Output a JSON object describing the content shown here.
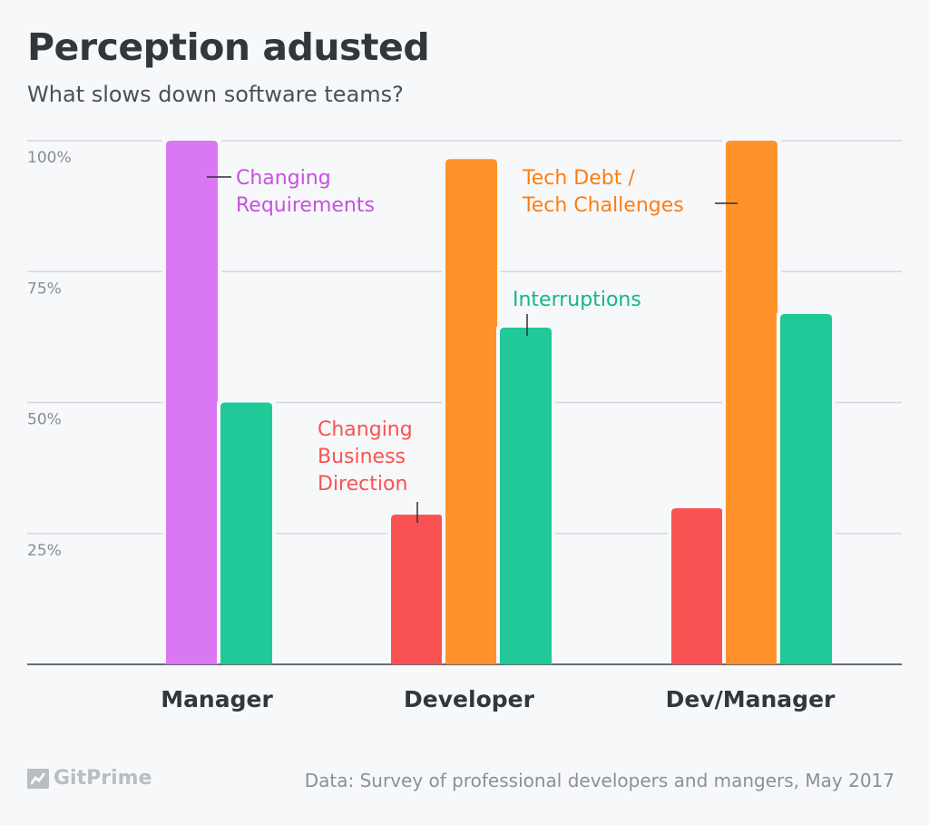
{
  "header": {
    "title": "Perception adusted",
    "subtitle": "What slows down software teams?"
  },
  "footer": {
    "logo_text": "GitPrime",
    "logo_icon": "gitprime-chart-icon",
    "source": "Data: Survey of professional developers and mangers, May 2017"
  },
  "colors": {
    "changing_requirements": "#da77f2",
    "changing_requirements_label": "#c850e0",
    "changing_business_direction": "#fa5252",
    "tech_debt": "#ff922b",
    "tech_debt_label": "#fd7e14",
    "interruptions": "#20c997",
    "interruptions_label": "#12b886"
  },
  "chart_data": {
    "type": "bar",
    "title": "Perception adusted",
    "subtitle": "What slows down software teams?",
    "xlabel": "",
    "ylabel": "",
    "ylim": [
      0,
      100
    ],
    "yticks": [
      25,
      50,
      75,
      100
    ],
    "ytick_labels": [
      "25%",
      "50%",
      "75%",
      "100%"
    ],
    "grid": true,
    "categories": [
      "Manager",
      "Developer",
      "Dev/Manager"
    ],
    "series": [
      {
        "name": "Changing Requirements",
        "key": "changing_requirements",
        "values": [
          100,
          null,
          null
        ]
      },
      {
        "name": "Changing Business Direction",
        "key": "changing_business_direction",
        "values": [
          null,
          28.6,
          29.8
        ]
      },
      {
        "name": "Tech Debt / Tech Challenges",
        "key": "tech_debt",
        "values": [
          null,
          96.5,
          100
        ]
      },
      {
        "name": "Interruptions",
        "key": "interruptions",
        "values": [
          50,
          64.3,
          66.9
        ]
      }
    ],
    "annotations": [
      {
        "text": [
          "Changing",
          "Requirements"
        ],
        "series": "changing_requirements",
        "category": "Manager"
      },
      {
        "text": [
          "Changing",
          "Business",
          "Direction"
        ],
        "series": "changing_business_direction",
        "category": "Developer"
      },
      {
        "text": [
          "Interruptions"
        ],
        "series": "interruptions",
        "category": "Developer"
      },
      {
        "text": [
          "Tech Debt /",
          "Tech Challenges"
        ],
        "series": "tech_debt",
        "category": "Dev/Manager"
      }
    ]
  }
}
